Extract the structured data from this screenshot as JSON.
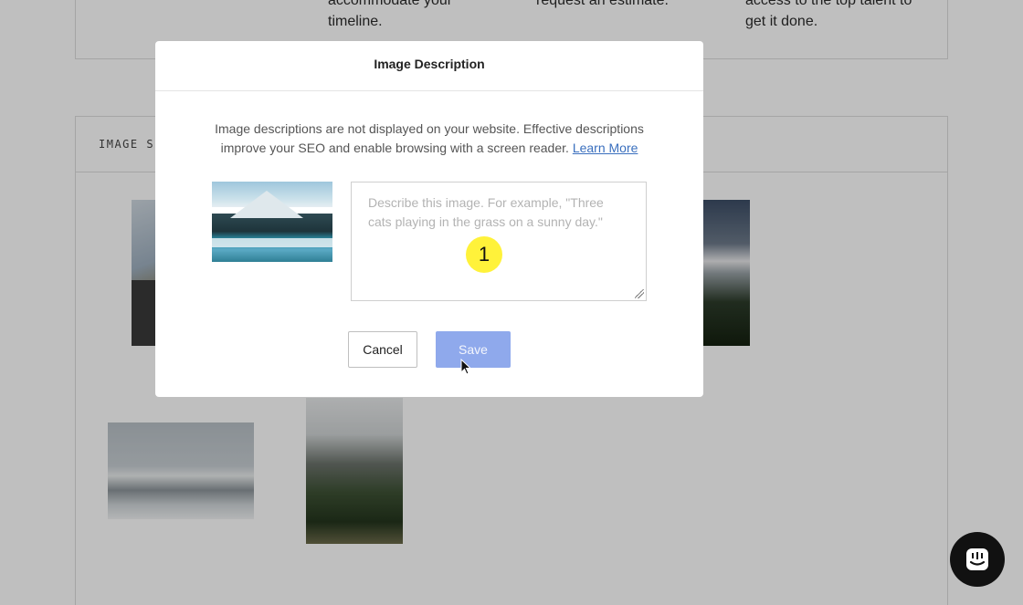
{
  "background": {
    "how_it_works": [
      "accommodate your timeline.",
      "request an estimate.",
      "access to the top talent to get it done."
    ],
    "image_section_title": "IMAGE SE"
  },
  "modal": {
    "title": "Image Description",
    "description": "Image descriptions are not displayed on your website. Effective descriptions improve your SEO and enable browsing with a screen reader.",
    "learn_more": "Learn More",
    "textarea_placeholder": "Describe this image. For example, \"Three cats playing in the grass on a sunny day.\"",
    "textarea_value": "",
    "step_badge": "1",
    "cancel_label": "Cancel",
    "save_label": "Save"
  },
  "colors": {
    "save_button": "#8fa9ec",
    "step_badge": "#fff23a",
    "link": "#3a6fbe",
    "chat_button": "#111111"
  },
  "icons": {
    "chat": "chat-icon",
    "cursor": "arrow-cursor-icon"
  }
}
